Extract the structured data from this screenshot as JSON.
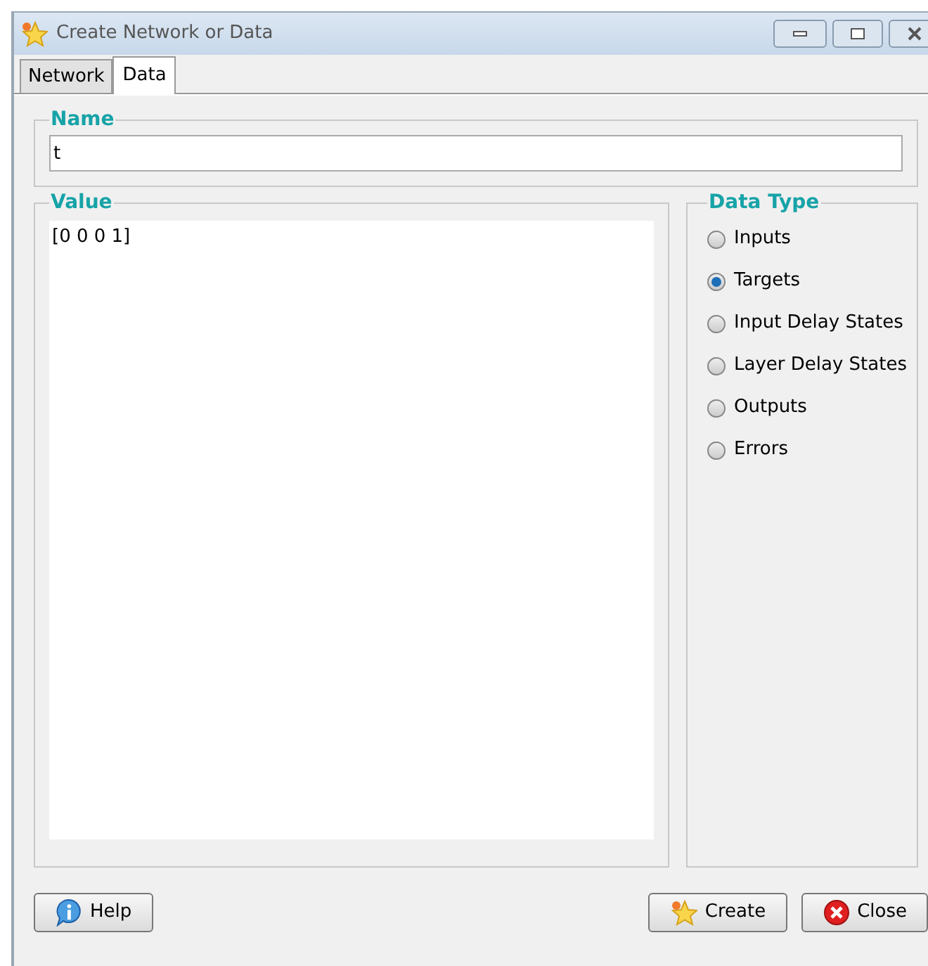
{
  "window": {
    "title": "Create Network or Data"
  },
  "tabs": [
    {
      "label": "Network",
      "selected": false
    },
    {
      "label": "Data",
      "selected": true
    }
  ],
  "name_group": {
    "legend": "Name",
    "value": "t"
  },
  "value_group": {
    "legend": "Value",
    "value": "[0 0 0 1]"
  },
  "data_type": {
    "legend": "Data Type",
    "options": [
      {
        "label": "Inputs",
        "selected": false
      },
      {
        "label": "Targets",
        "selected": true
      },
      {
        "label": "Input Delay States",
        "selected": false
      },
      {
        "label": "Layer Delay States",
        "selected": false
      },
      {
        "label": "Outputs",
        "selected": false
      },
      {
        "label": "Errors",
        "selected": false
      }
    ]
  },
  "buttons": [
    {
      "label": "Help",
      "kind": "help"
    },
    {
      "label": "Create",
      "kind": "create"
    },
    {
      "label": "Close",
      "kind": "close"
    }
  ]
}
